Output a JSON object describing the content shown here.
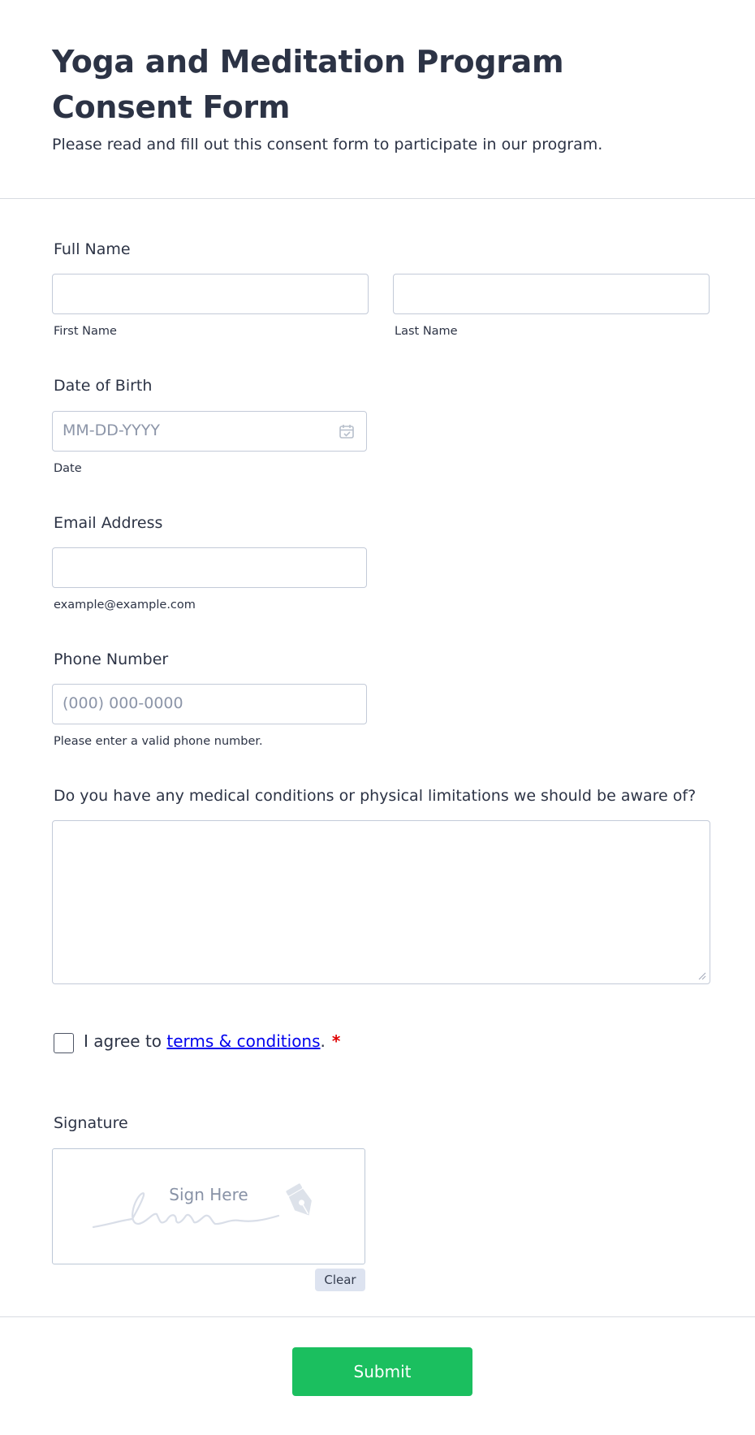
{
  "header": {
    "title": "Yoga and Meditation Program Consent Form",
    "subtitle": "Please read and fill out this consent form to participate in our program."
  },
  "full_name": {
    "label": "Full Name",
    "first_sublabel": "First Name",
    "last_sublabel": "Last Name",
    "first_value": "",
    "last_value": ""
  },
  "dob": {
    "label": "Date of Birth",
    "placeholder": "MM-DD-YYYY",
    "sublabel": "Date",
    "icon": "calendar-icon"
  },
  "email": {
    "label": "Email Address",
    "value": "",
    "sublabel": "example@example.com"
  },
  "phone": {
    "label": "Phone Number",
    "placeholder": "(000) 000-0000",
    "sublabel": "Please enter a valid phone number."
  },
  "medical": {
    "label": "Do you have any medical conditions or physical limitations we should be aware of?",
    "value": ""
  },
  "terms": {
    "prefix": "I agree to",
    "link": "terms & conditions",
    "suffix": ".",
    "required_mark": "*",
    "checked": false
  },
  "signature": {
    "label": "Signature",
    "placeholder": "Sign Here",
    "clear_label": "Clear",
    "icon": "pen-nib-icon"
  },
  "submit_label": "Submit",
  "colors": {
    "text": "#2c3345",
    "border": "#c3cad8",
    "placeholder": "#8c95a8",
    "submit": "#1bbf5f",
    "required": "#e00000",
    "link": "#0000ee"
  }
}
